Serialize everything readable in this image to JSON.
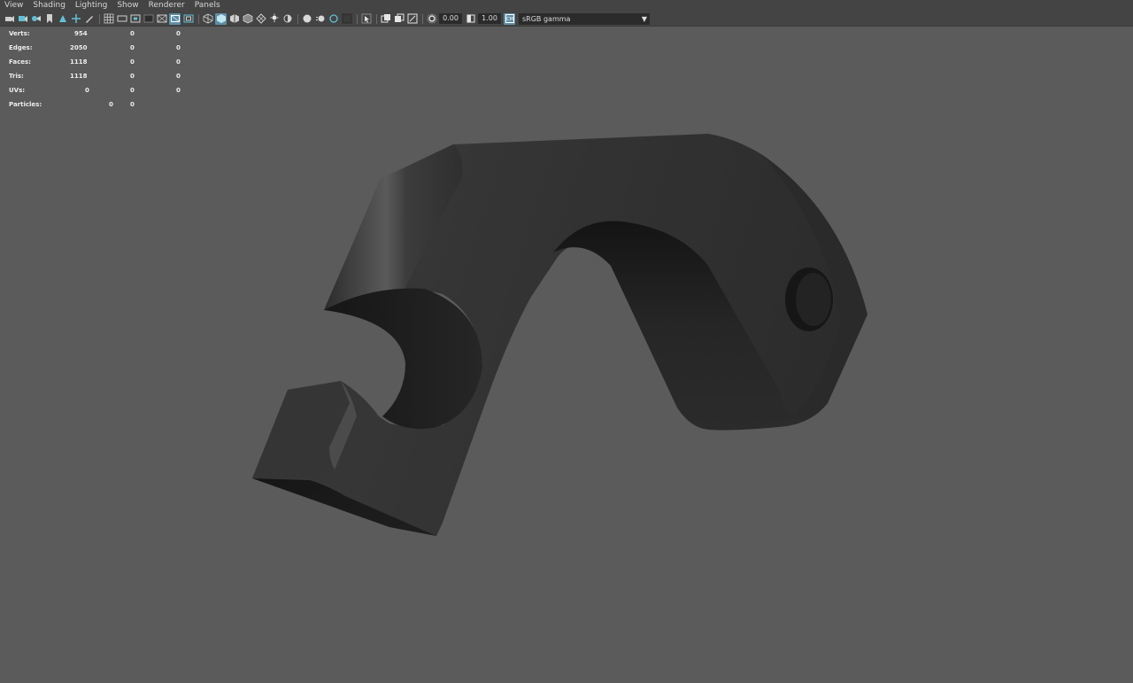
{
  "menu": [
    "View",
    "Shading",
    "Lighting",
    "Show",
    "Renderer",
    "Panels"
  ],
  "toolbar": {
    "exposure_value": "0.00",
    "gamma_value": "1.00",
    "color_space": "sRGB gamma",
    "colors": {
      "bar": "#444444",
      "active_icon": "#5e8ea6",
      "icon": "#cfcfcf"
    }
  },
  "hud": {
    "rows": [
      {
        "label": "Verts:",
        "values": [
          "954",
          "0",
          "0"
        ]
      },
      {
        "label": "Edges:",
        "values": [
          "2050",
          "0",
          "0"
        ]
      },
      {
        "label": "Faces:",
        "values": [
          "1118",
          "0",
          "0"
        ]
      },
      {
        "label": "Tris:",
        "values": [
          "1118",
          "0",
          "0"
        ]
      },
      {
        "label": "UVs:",
        "values": [
          "0",
          "0",
          "0"
        ]
      },
      {
        "label": "Particles:",
        "values": [
          "0",
          "0"
        ]
      }
    ]
  },
  "viewport": {
    "background": "#5b5b5b",
    "model": "dark-gray-bracket-mesh"
  }
}
